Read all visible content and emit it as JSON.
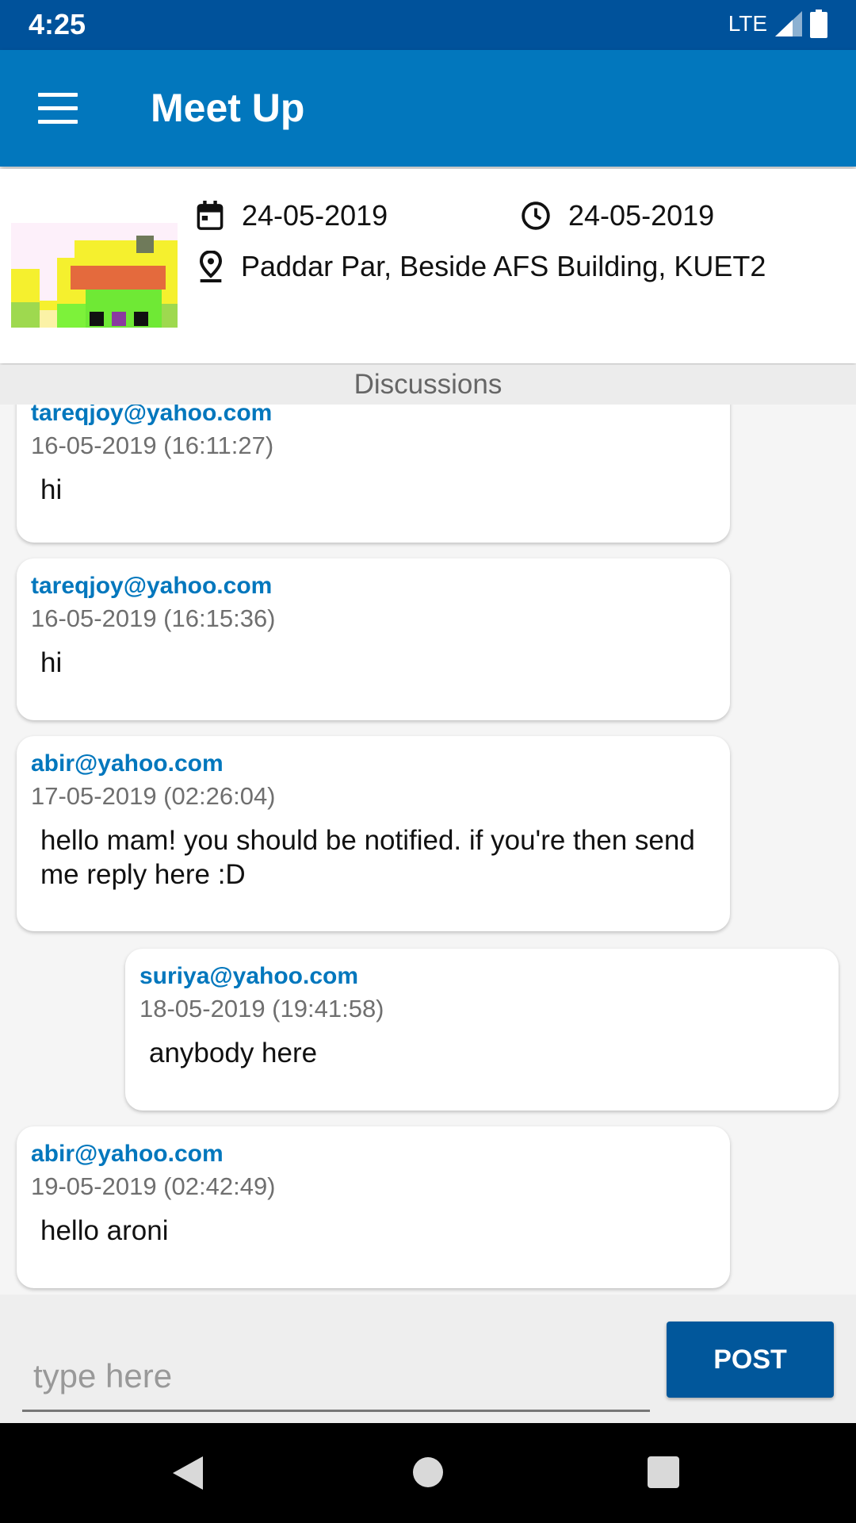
{
  "status": {
    "time": "4:25",
    "network": "LTE"
  },
  "app_bar": {
    "title": "Meet Up"
  },
  "event": {
    "date": "24-05-2019",
    "time": "24-05-2019",
    "location": "Paddar Par, Beside AFS Building, KUET2"
  },
  "discussions_label": "Discussions",
  "messages": [
    {
      "author": "tareqjoy@yahoo.com",
      "timestamp": "16-05-2019 (16:11:27)",
      "text": "hi"
    },
    {
      "author": "tareqjoy@yahoo.com",
      "timestamp": "16-05-2019 (16:15:36)",
      "text": "hi"
    },
    {
      "author": "abir@yahoo.com",
      "timestamp": "17-05-2019 (02:26:04)",
      "text": "hello mam! you should be notified. if you're then send me reply here :D"
    },
    {
      "author": "suriya@yahoo.com",
      "timestamp": "18-05-2019 (19:41:58)",
      "text": "anybody here"
    },
    {
      "author": "abir@yahoo.com",
      "timestamp": "19-05-2019 (02:42:49)",
      "text": "hello aroni"
    }
  ],
  "composer": {
    "placeholder": "type here",
    "value": "",
    "post_label": "POST"
  },
  "colors": {
    "status_bar": "#00529b",
    "app_bar": "#0277bd",
    "author": "#0277bd",
    "post_button": "#01579b"
  }
}
